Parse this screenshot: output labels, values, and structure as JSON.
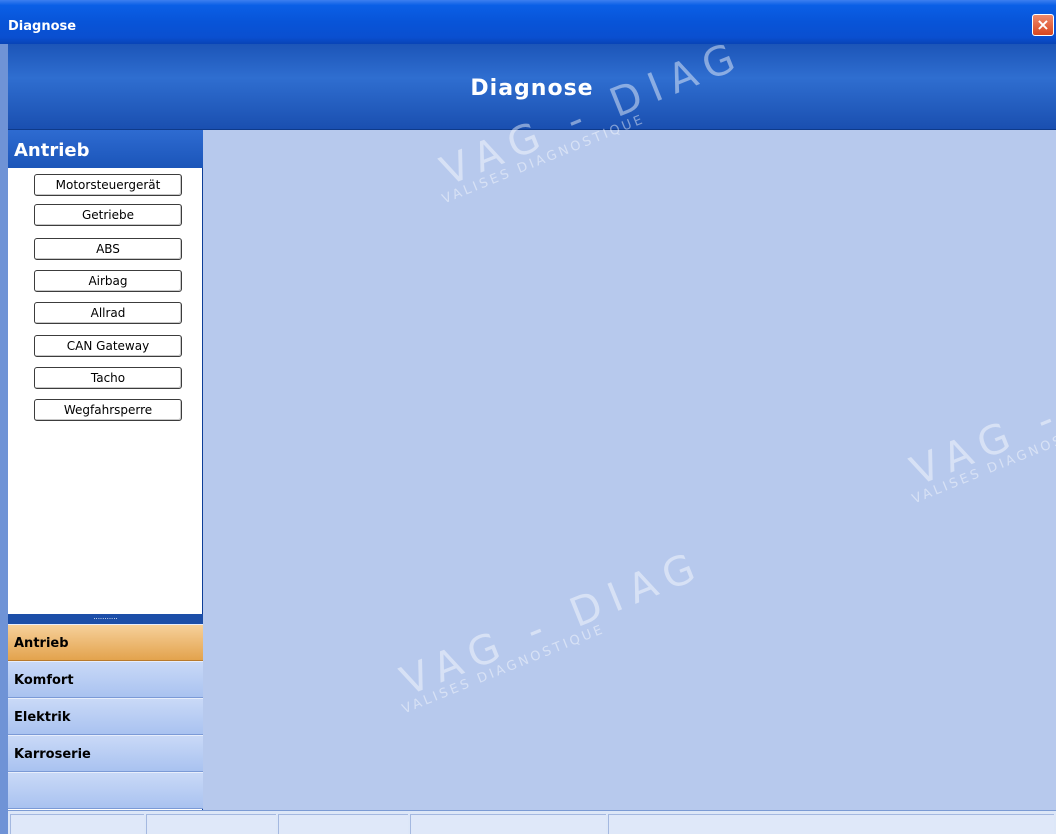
{
  "window": {
    "title": "Diagnose",
    "close_label": "×"
  },
  "header": {
    "title": "Diagnose"
  },
  "sidebar": {
    "group_title": "Antrieb",
    "modules": [
      {
        "label": "Motorsteuergerät"
      },
      {
        "label": "Getriebe"
      },
      {
        "label": "ABS"
      },
      {
        "label": "Airbag"
      },
      {
        "label": "Allrad"
      },
      {
        "label": "CAN Gateway"
      },
      {
        "label": "Tacho"
      },
      {
        "label": "Wegfahrsperre"
      }
    ],
    "splitter_label": "...........",
    "nav": [
      {
        "label": "Antrieb",
        "active": true
      },
      {
        "label": "Komfort",
        "active": false
      },
      {
        "label": "Elektrik",
        "active": false
      },
      {
        "label": "Karroserie",
        "active": false
      },
      {
        "label": "",
        "active": false
      }
    ]
  },
  "watermark": {
    "main": "VAG - DIAG",
    "sub": "VALISES DIAGNOSTIQUE"
  },
  "colors": {
    "accent": "#0a5fe6",
    "active_nav": "#e3a34d",
    "content_bg": "#b7c9ed"
  }
}
